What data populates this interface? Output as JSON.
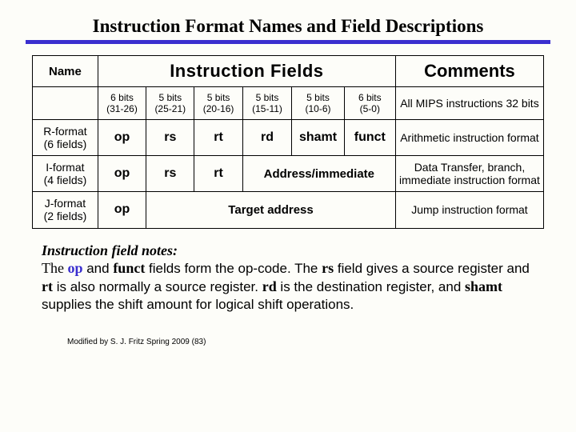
{
  "title": "Instruction Format Names and Field Descriptions",
  "headers": {
    "name": "Name",
    "fields": "Instruction Fields",
    "comments": "Comments"
  },
  "bitcols": [
    {
      "top": "6 bits",
      "bottom": "(31-26)"
    },
    {
      "top": "5 bits",
      "bottom": "(25-21)"
    },
    {
      "top": "5 bits",
      "bottom": "(20-16)"
    },
    {
      "top": "5 bits",
      "bottom": "(15-11)"
    },
    {
      "top": "5 bits",
      "bottom": "(10-6)"
    },
    {
      "top": "6 bits",
      "bottom": "(5-0)"
    }
  ],
  "bitrow_comment": "All MIPS instructions 32 bits",
  "rformat": {
    "name": "R-format\n(6 fields)",
    "fields": [
      "op",
      "rs",
      "rt",
      "rd",
      "shamt",
      "funct"
    ],
    "comment": "Arithmetic instruction format"
  },
  "iformat": {
    "name": "I-format\n(4 fields)",
    "fields": [
      "op",
      "rs",
      "rt"
    ],
    "merged": "Address/immediate",
    "comment": "Data Transfer, branch, immediate instruction format"
  },
  "jformat": {
    "name": "J-format\n(2 fields)",
    "fields": [
      "op"
    ],
    "merged": "Target address",
    "comment": "Jump instruction format"
  },
  "notes": {
    "heading": "Instruction field notes:",
    "t1a": "The ",
    "op": "op",
    "t1b": " and ",
    "funct": "funct",
    "t1c": " fields form the op-code. The ",
    "rs": "rs",
    "t1d": " field gives a source register and ",
    "rt": "rt",
    "t1e": " is also normally a source register. ",
    "rd": "rd",
    "t1f": " is the destination register, and ",
    "shamt": "shamt",
    "t1g": " supplies the shift amount for logical shift operations."
  },
  "footer": "Modified by S. J. Fritz Spring 2009 (83)",
  "chart_data": {
    "type": "table",
    "title": "Instruction Format Names and Field Descriptions",
    "bit_ranges": [
      "31-26",
      "25-21",
      "20-16",
      "15-11",
      "10-6",
      "5-0"
    ],
    "bit_widths": [
      6,
      5,
      5,
      5,
      5,
      6
    ],
    "formats": [
      {
        "name": "R-format",
        "field_count": 6,
        "fields": [
          "op",
          "rs",
          "rt",
          "rd",
          "shamt",
          "funct"
        ],
        "comment": "Arithmetic instruction format"
      },
      {
        "name": "I-format",
        "field_count": 4,
        "fields": [
          "op",
          "rs",
          "rt",
          "Address/immediate"
        ],
        "comment": "Data Transfer, branch, immediate instruction format"
      },
      {
        "name": "J-format",
        "field_count": 2,
        "fields": [
          "op",
          "Target address"
        ],
        "comment": "Jump instruction format"
      }
    ],
    "overall_comment": "All MIPS instructions 32 bits"
  }
}
